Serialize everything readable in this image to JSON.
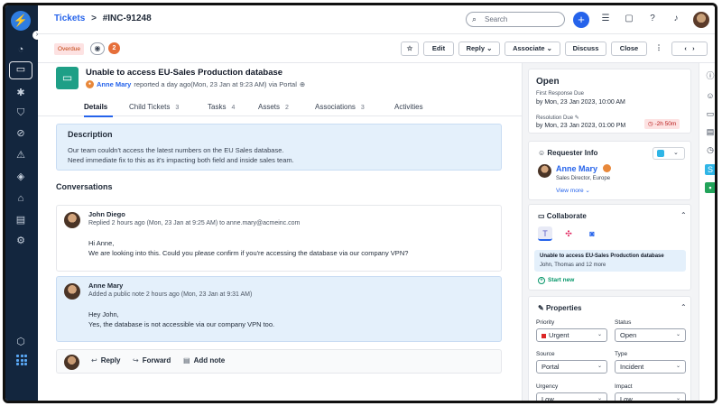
{
  "header": {
    "breadcrumb_root": "Tickets",
    "breadcrumb_sep": ">",
    "ticket_id": "#INC-91248",
    "search_placeholder": "Search"
  },
  "actions": {
    "overdue": "Overdue",
    "viewers": "2",
    "edit": "Edit",
    "reply": "Reply",
    "associate": "Associate",
    "discuss": "Discuss",
    "close": "Close"
  },
  "ticket": {
    "title": "Unable to access EU-Sales Production database",
    "reporter": "Anne Mary",
    "reported_meta": "reported a day ago(Mon, 23 Jan at 9:23 AM) via Portal"
  },
  "tabs": [
    {
      "label": "Details",
      "count": ""
    },
    {
      "label": "Child Tickets",
      "count": "3"
    },
    {
      "label": "Tasks",
      "count": "4"
    },
    {
      "label": "Assets",
      "count": "2"
    },
    {
      "label": "Associations",
      "count": "3"
    },
    {
      "label": "Activities",
      "count": ""
    }
  ],
  "description": {
    "heading": "Description",
    "line1": "Our team couldn't access the latest numbers on the EU Sales database.",
    "line2": "Need immediate fix to this as it's impacting both field and inside sales team."
  },
  "conversations": {
    "heading": "Conversations",
    "messages": [
      {
        "author": "John Diego",
        "meta": "Replied 2 hours ago (Mon, 23 Jan at 9:25 AM) to anne.mary@acmeinc.com",
        "line1": "Hi Anne,",
        "line2": "We are looking into this. Could you please confirm if you're accessing the database via our company VPN?"
      },
      {
        "author": "Anne Mary",
        "meta": "Added a public note 2 hours ago (Mon, 23 Jan at 9:31 AM)",
        "line1": "Hey John,",
        "line2": "Yes, the database is not accessible via our company VPN too."
      }
    ],
    "reply": "Reply",
    "forward": "Forward",
    "add_note": "Add note"
  },
  "status": {
    "title": "Open",
    "first_response_label": "First Response Due",
    "first_response_value": "by Mon, 23 Jan 2023, 10:00 AM",
    "resolution_label": "Resolution Due",
    "resolution_value": "by Mon, 23 Jan 2023, 01:00 PM",
    "overdue_time": "-2h 50m"
  },
  "requester": {
    "heading": "Requester Info",
    "name": "Anne Mary",
    "role": "Sales Director, Europe",
    "view_more": "View more"
  },
  "collaborate": {
    "heading": "Collaborate",
    "item_title": "Unable to access EU-Sales Production database",
    "item_people": "John, Thomas and 12 more",
    "start_new": "Start new"
  },
  "properties": {
    "heading": "Properties",
    "priority_label": "Priority",
    "priority_value": "Urgent",
    "status_label": "Status",
    "status_value": "Open",
    "source_label": "Source",
    "source_value": "Portal",
    "type_label": "Type",
    "type_value": "Incident",
    "urgency_label": "Urgency",
    "urgency_value": "Low",
    "impact_label": "Impact",
    "impact_value": "Low"
  },
  "colors": {
    "rail": "#13263e",
    "accent": "#2563eb",
    "ticket_icon": "#1e9f86",
    "note_bg": "#e4f0fb",
    "urgent": "#dc2626"
  }
}
